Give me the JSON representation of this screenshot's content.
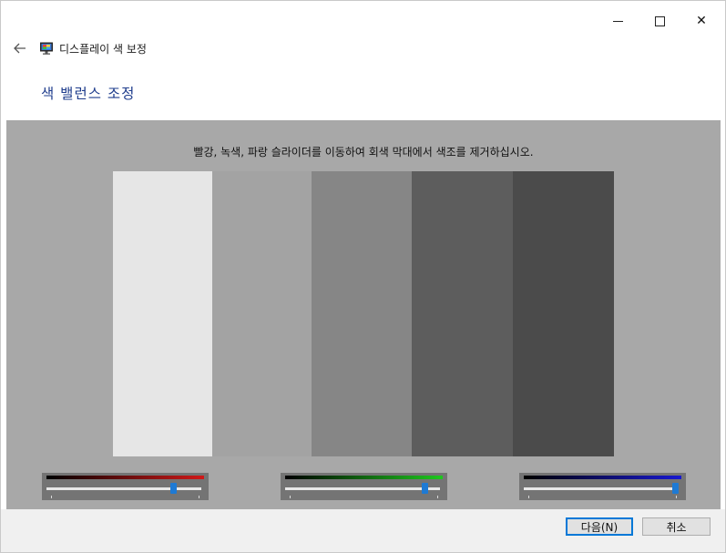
{
  "window": {
    "title": "디스플레이 색 보정",
    "heading": "색 밸런스 조정"
  },
  "caption": {
    "minimize_icon": "minimize-icon",
    "maximize_icon": "maximize-icon",
    "close_icon": "close-icon",
    "close_glyph": "✕"
  },
  "nav": {
    "back_icon": "back-arrow-icon",
    "app_icon": "monitor-icon"
  },
  "calibration": {
    "instruction": "빨강, 녹색, 파랑 슬라이더를 이동하여 회색 막대에서 색조를 제거하십시오.",
    "background_color": "#a8a8a8",
    "bar_colors": [
      "#e6e6e6",
      "#a3a3a3",
      "#868686",
      "#5d5d5d",
      "#4b4b4b"
    ]
  },
  "sliders": [
    {
      "name": "red",
      "gradient_color": "#d01818",
      "value_fraction": 0.82
    },
    {
      "name": "green",
      "gradient_color": "#1ec81e",
      "value_fraction": 0.9
    },
    {
      "name": "blue",
      "gradient_color": "#1818d0",
      "value_fraction": 0.98
    }
  ],
  "footer": {
    "next_label": "다음(N)",
    "cancel_label": "취소"
  },
  "colors": {
    "accent": "#0078d7",
    "heading": "#1e3c8c",
    "thumb": "#1e7ad4"
  }
}
